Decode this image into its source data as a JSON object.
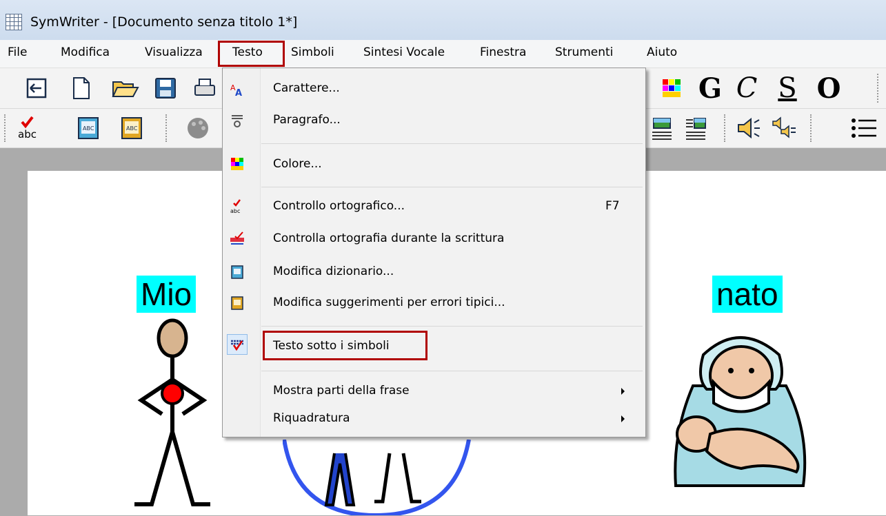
{
  "window": {
    "title": "SymWriter - [Documento senza titolo 1*]"
  },
  "menubar": {
    "items": [
      "File",
      "Modifica",
      "Visualizza",
      "Testo",
      "Simboli",
      "Sintesi Vocale",
      "Finestra",
      "Strumenti",
      "Aiuto"
    ],
    "active": "Testo"
  },
  "toolbar": {
    "format_buttons": {
      "bold": "G",
      "italic": "C",
      "underline": "S",
      "outline": "O"
    }
  },
  "document": {
    "symbol_words": [
      "Mio",
      "nato"
    ]
  },
  "testo_menu": {
    "items": [
      {
        "label": "Carattere...",
        "icon": "font-icon"
      },
      {
        "label": "Paragrafo...",
        "icon": "paragraph-icon"
      },
      {
        "label": "Colore...",
        "icon": "color-palette-icon"
      },
      {
        "label": "Controllo ortografico...",
        "shortcut": "F7",
        "icon": "spellcheck-icon"
      },
      {
        "label": "Controlla ortografia durante la scrittura",
        "icon": "live-spellcheck-icon"
      },
      {
        "label": "Modifica dizionario...",
        "icon": "dictionary-icon"
      },
      {
        "label": "Modifica suggerimenti per errori tipici...",
        "icon": "suggestions-icon"
      },
      {
        "label": "Testo sotto i simboli",
        "icon": "text-below-symbols-icon",
        "checked": true,
        "highlighted": true
      },
      {
        "label": "Mostra parti della frase",
        "submenu": true
      },
      {
        "label": "Riquadratura",
        "submenu": true
      }
    ]
  },
  "colors": {
    "highlight_border": "#b00000",
    "word_background": "#00ffff"
  }
}
